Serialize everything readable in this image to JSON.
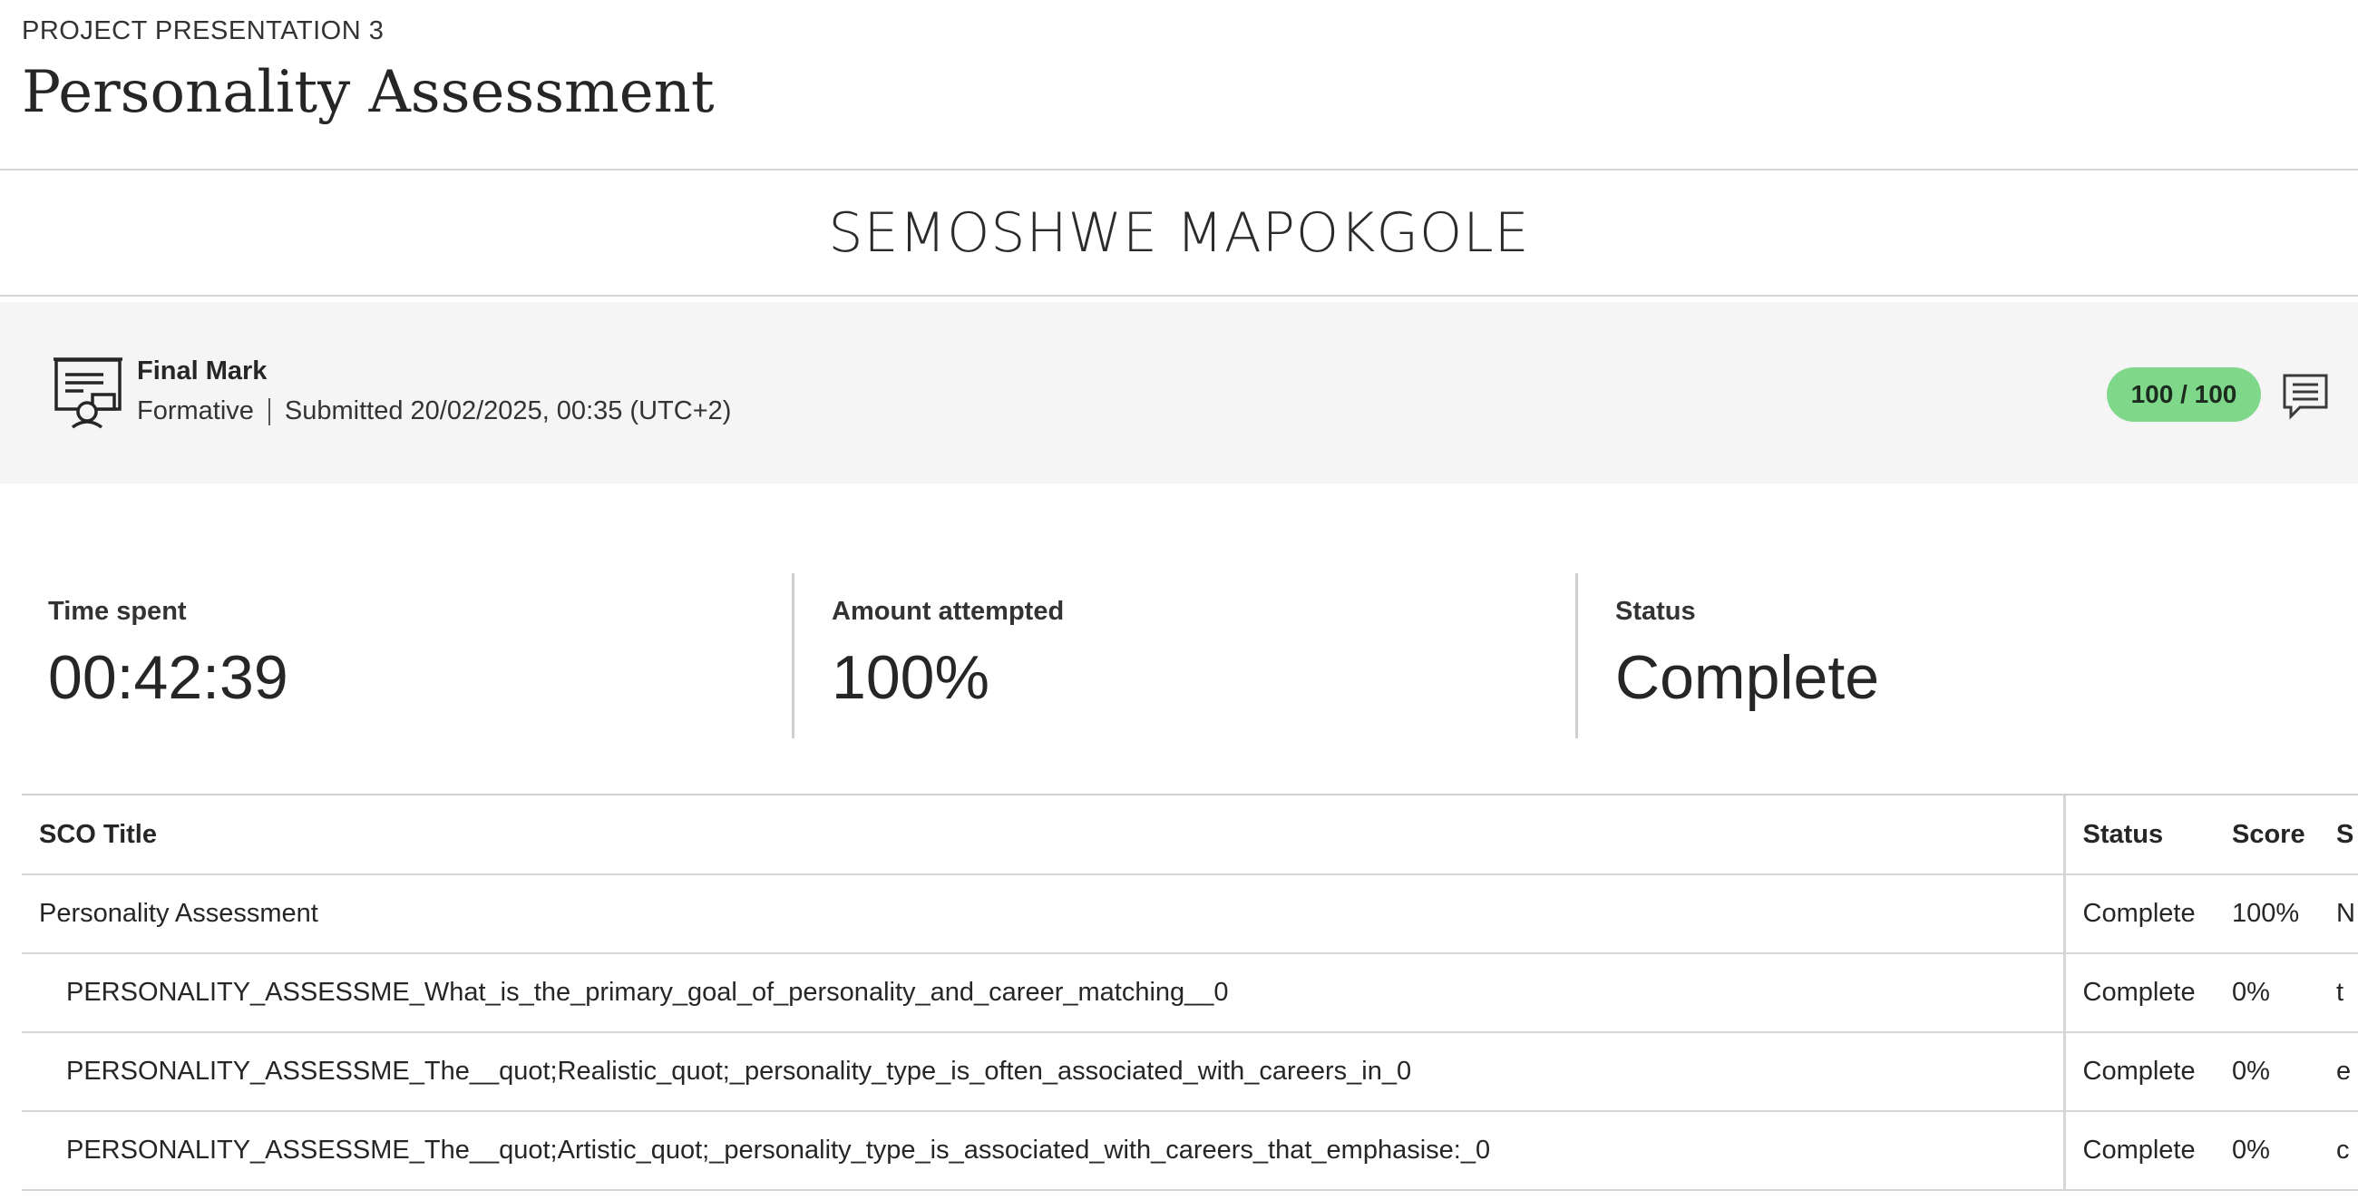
{
  "breadcrumb": "PROJECT PRESENTATION 3",
  "title": "Personality Assessment",
  "student_name": "SEMOSHWE MAPOKGOLE",
  "grade": {
    "label": "Final Mark",
    "type": "Formative",
    "submitted": "Submitted 20/02/2025, 00:35 (UTC+2)",
    "score": "100 / 100",
    "icon": "certificate-icon",
    "comment_icon": "comment-icon"
  },
  "stats": {
    "time_spent": {
      "label": "Time spent",
      "value": "00:42:39"
    },
    "amount_attempted": {
      "label": "Amount attempted",
      "value": "100%"
    },
    "status": {
      "label": "Status",
      "value": "Complete"
    }
  },
  "table": {
    "headers": [
      "SCO Title",
      "Status",
      "Score",
      "S"
    ],
    "rows": [
      {
        "title": "Personality Assessment",
        "status": "Complete",
        "score": "100%",
        "extra": "N"
      },
      {
        "title": "PERSONALITY_ASSESSME_What_is_the_primary_goal_of_personality_and_career_matching__0",
        "status": "Complete",
        "score": "0%",
        "extra": "t"
      },
      {
        "title": "PERSONALITY_ASSESSME_The__quot;Realistic_quot;_personality_type_is_often_associated_with_careers_in_0",
        "status": "Complete",
        "score": "0%",
        "extra": "e"
      },
      {
        "title": "PERSONALITY_ASSESSME_The__quot;Artistic_quot;_personality_type_is_associated_with_careers_that_emphasise:_0",
        "status": "Complete",
        "score": "0%",
        "extra": "c"
      }
    ]
  },
  "colors": {
    "score_badge": "#7fd88a",
    "panel_bg": "#f5f5f5",
    "divider": "#d5d5d5"
  }
}
